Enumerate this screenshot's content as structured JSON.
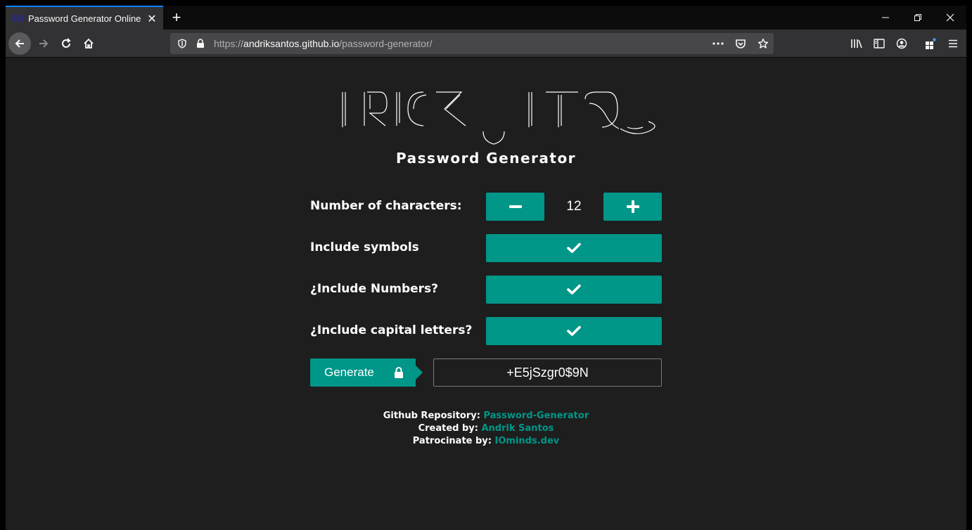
{
  "browser": {
    "tab": {
      "title": "Password Generator Online",
      "close_icon": "close-icon"
    },
    "new_tab_label": "+",
    "url": {
      "scheme": "https://",
      "host": "andriksantos.github.io",
      "path": "/password-generator/"
    }
  },
  "page": {
    "title": "Password Generator",
    "rows": {
      "characters": {
        "label": "Number of characters:",
        "value": "12"
      },
      "symbols": {
        "label": "Include symbols",
        "checked": true
      },
      "numbers": {
        "label": "¿Include Numbers?",
        "checked": true
      },
      "capitals": {
        "label": "¿Include capital letters?",
        "checked": true
      }
    },
    "generate_label": "Generate",
    "password": "+E5jSzgr0$9N",
    "footer": {
      "repo_label": "Github Repository:",
      "repo_link": "Password-Generator",
      "created_label": "Created by:",
      "created_link": "Andrik Santos",
      "patron_label": "Patrocinate by:",
      "patron_link": "IOminds.dev"
    },
    "accent_color": "#009688"
  }
}
